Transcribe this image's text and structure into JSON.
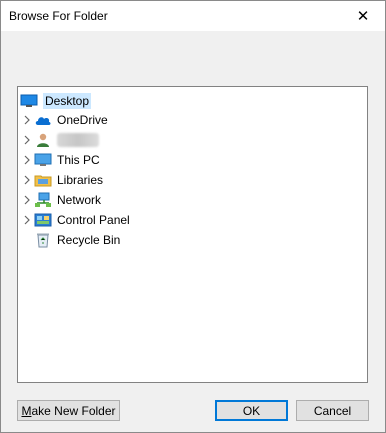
{
  "window": {
    "title": "Browse For Folder",
    "close_glyph": "✕"
  },
  "tree": {
    "root": {
      "label": "Desktop",
      "icon": "desktop-icon",
      "selected": true
    },
    "items": [
      {
        "label": "OneDrive",
        "icon": "cloud-icon",
        "expandable": true
      },
      {
        "label": "",
        "icon": "user-icon",
        "expandable": true,
        "blurred": true
      },
      {
        "label": "This PC",
        "icon": "computer-icon",
        "expandable": true
      },
      {
        "label": "Libraries",
        "icon": "libraries-icon",
        "expandable": true
      },
      {
        "label": "Network",
        "icon": "network-icon",
        "expandable": true
      },
      {
        "label": "Control Panel",
        "icon": "control-panel-icon",
        "expandable": true
      },
      {
        "label": "Recycle Bin",
        "icon": "recycle-bin-icon",
        "expandable": false
      }
    ]
  },
  "buttons": {
    "make_new_folder_accel": "M",
    "make_new_folder_rest": "ake New Folder",
    "ok": "OK",
    "cancel": "Cancel"
  },
  "colors": {
    "selection": "#cce8ff",
    "accent": "#0078d7"
  }
}
